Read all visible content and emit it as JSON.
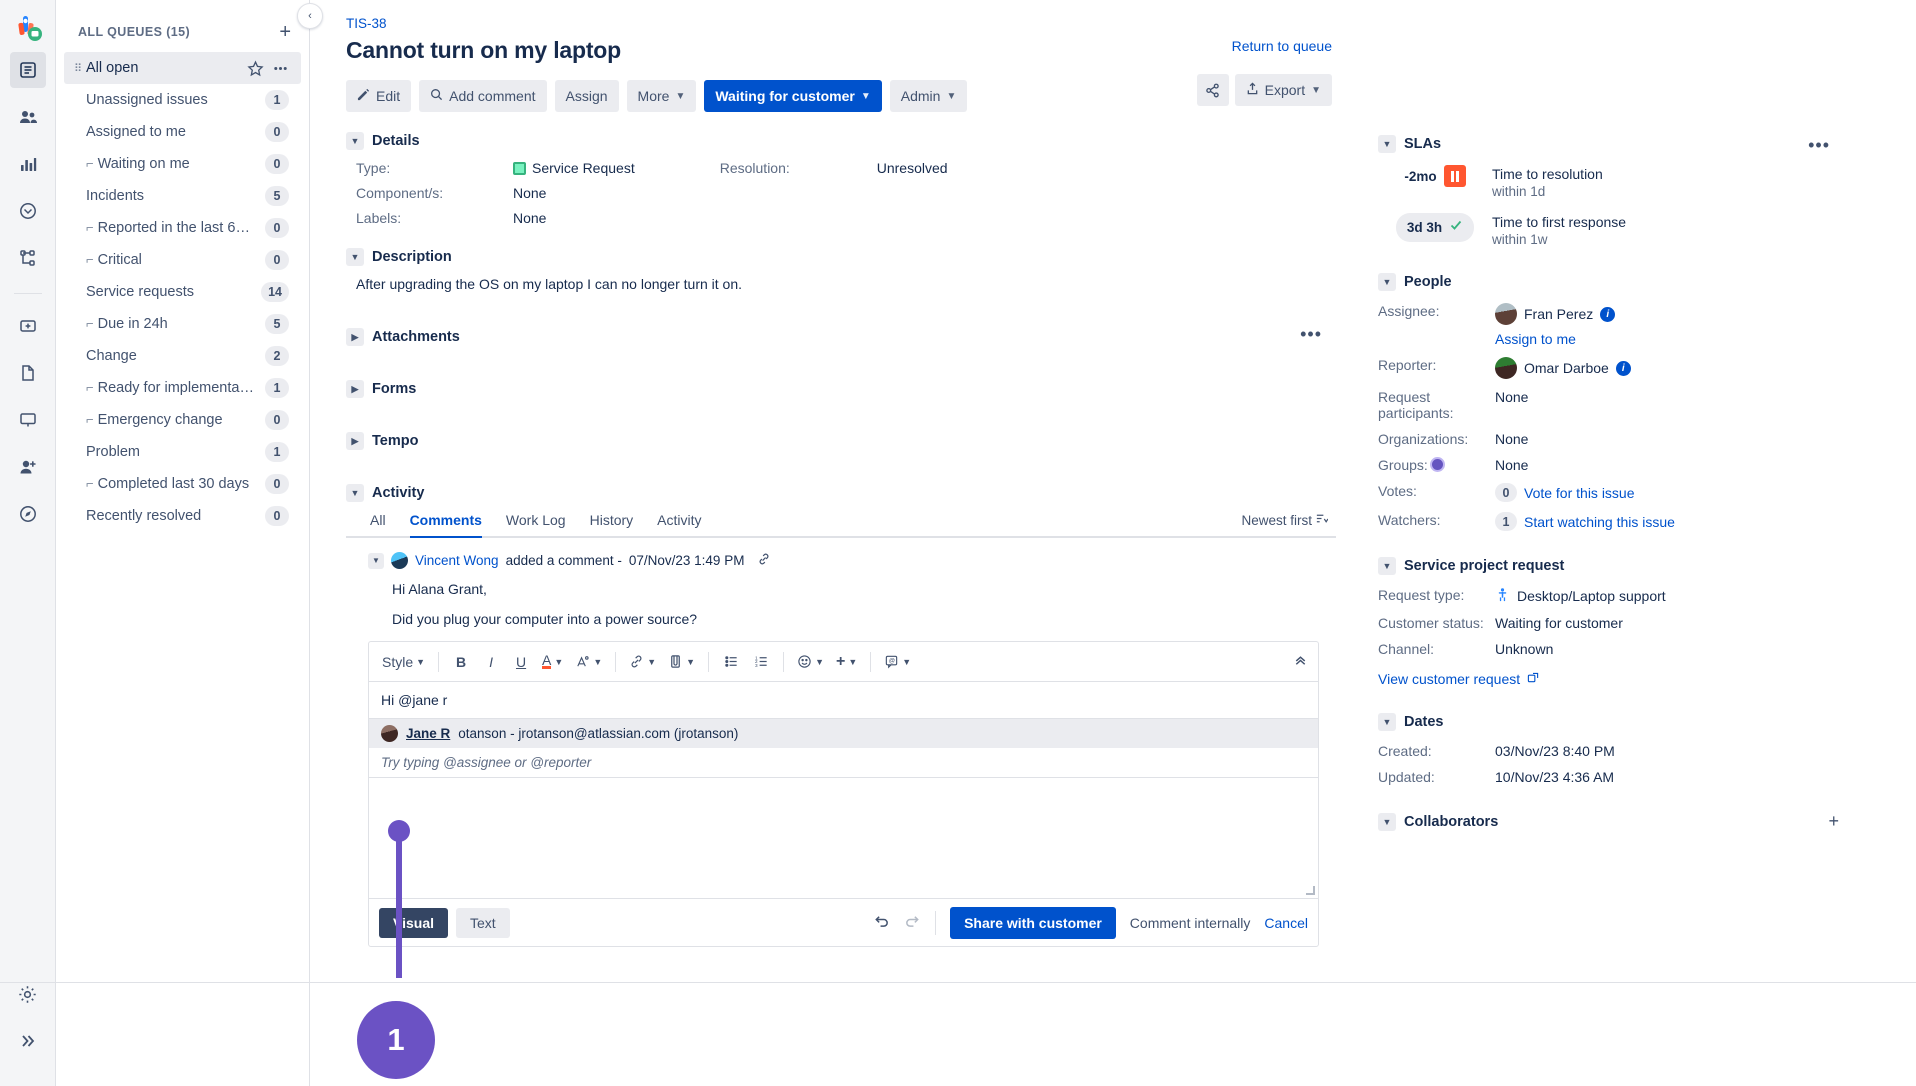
{
  "rail": {
    "logo": "jira-service-management-logo",
    "items": [
      {
        "name": "queues-icon",
        "active": true
      },
      {
        "name": "customers-icon",
        "active": false
      },
      {
        "name": "reports-icon",
        "active": false
      },
      {
        "name": "sla-clock-icon",
        "active": false
      },
      {
        "name": "workflow-icon",
        "active": false
      },
      {
        "name": "add-form-icon",
        "active": false
      },
      {
        "name": "knowledge-base-icon",
        "active": false
      },
      {
        "name": "assets-icon",
        "active": false
      },
      {
        "name": "invite-team-icon",
        "active": false
      },
      {
        "name": "compass-icon",
        "active": false
      }
    ],
    "settings_icon": "gear-icon",
    "expand_icon": "double-chevron-right-icon"
  },
  "queues": {
    "title": "ALL QUEUES (15)",
    "add_label": "+",
    "collapse_label": "‹",
    "items": [
      {
        "label": "All open",
        "count": "",
        "sub": false,
        "selected": true
      },
      {
        "label": "Unassigned issues",
        "count": "1",
        "sub": false,
        "selected": false
      },
      {
        "label": "Assigned to me",
        "count": "0",
        "sub": false,
        "selected": false
      },
      {
        "label": "Waiting on me",
        "count": "0",
        "sub": true,
        "selected": false
      },
      {
        "label": "Incidents",
        "count": "5",
        "sub": false,
        "selected": false
      },
      {
        "label": "Reported in the last 60 ...",
        "count": "0",
        "sub": true,
        "selected": false
      },
      {
        "label": "Critical",
        "count": "0",
        "sub": true,
        "selected": false
      },
      {
        "label": "Service requests",
        "count": "14",
        "sub": false,
        "selected": false
      },
      {
        "label": "Due in 24h",
        "count": "5",
        "sub": true,
        "selected": false
      },
      {
        "label": "Change",
        "count": "2",
        "sub": false,
        "selected": false
      },
      {
        "label": "Ready for implementation",
        "count": "1",
        "sub": true,
        "selected": false
      },
      {
        "label": "Emergency change",
        "count": "0",
        "sub": true,
        "selected": false
      },
      {
        "label": "Problem",
        "count": "1",
        "sub": false,
        "selected": false
      },
      {
        "label": "Completed last 30 days",
        "count": "0",
        "sub": true,
        "selected": false
      },
      {
        "label": "Recently resolved",
        "count": "0",
        "sub": false,
        "selected": false
      }
    ]
  },
  "issue": {
    "key": "TIS-38",
    "title": "Cannot turn on my laptop",
    "return_to_queue": "Return to queue"
  },
  "toolbar": {
    "edit": "Edit",
    "add_comment": "Add comment",
    "assign": "Assign",
    "more": "More",
    "status": "Waiting for customer",
    "admin": "Admin",
    "export": "Export",
    "share_icon": "share-icon"
  },
  "details": {
    "heading": "Details",
    "type_label": "Type:",
    "type_value": "Service Request",
    "components_label": "Component/s:",
    "components_value": "None",
    "labels_label": "Labels:",
    "labels_value": "None",
    "resolution_label": "Resolution:",
    "resolution_value": "Unresolved"
  },
  "description": {
    "heading": "Description",
    "text": "After upgrading the OS on my laptop I can no longer turn it on."
  },
  "sections": {
    "attachments": "Attachments",
    "forms": "Forms",
    "tempo": "Tempo",
    "activity": "Activity"
  },
  "activity": {
    "tabs": [
      {
        "label": "All",
        "active": false
      },
      {
        "label": "Comments",
        "active": true
      },
      {
        "label": "Work Log",
        "active": false
      },
      {
        "label": "History",
        "active": false
      },
      {
        "label": "Activity",
        "active": false
      }
    ],
    "sort": "Newest first",
    "sort_icon": "sort-descending-icon"
  },
  "comment": {
    "author": "Vincent Wong",
    "action": "added a comment -",
    "timestamp": "07/Nov/23 1:49 PM",
    "permalink_icon": "link-icon",
    "line1": "Hi Alana Grant,",
    "line2": "Did you plug your computer into a power source?"
  },
  "editor": {
    "style_label": "Style",
    "tools": [
      {
        "name": "bold-icon",
        "glyph": "B"
      },
      {
        "name": "italic-icon",
        "glyph": "I"
      },
      {
        "name": "underline-icon",
        "glyph": "U"
      },
      {
        "name": "text-color-icon",
        "glyph": "A"
      },
      {
        "name": "text-effects-icon",
        "glyph": "A"
      },
      {
        "name": "link-icon",
        "glyph": "🔗"
      },
      {
        "name": "attachment-icon",
        "glyph": "📎"
      },
      {
        "name": "bullet-list-icon",
        "glyph": "☰"
      },
      {
        "name": "numbered-list-icon",
        "glyph": "☲"
      },
      {
        "name": "emoji-icon",
        "glyph": "☺"
      },
      {
        "name": "insert-more-icon",
        "glyph": "+"
      },
      {
        "name": "mention-icon",
        "glyph": "⌨"
      }
    ],
    "collapse_icon": "chevron-up-double-icon",
    "body_text": "Hi @jane r",
    "mention_name_strong": "Jane R",
    "mention_name_rest": "otanson - jrotanson@atlassian.com (jrotanson)",
    "mention_hint": "Try typing @assignee or @reporter",
    "visual_tab": "Visual",
    "text_tab": "Text",
    "undo_icon": "undo-icon",
    "redo_icon": "redo-icon",
    "share_with_customer": "Share with customer",
    "comment_internally": "Comment internally",
    "cancel": "Cancel"
  },
  "slas": {
    "heading": "SLAs",
    "items": [
      {
        "time": "-2mo",
        "state": "breached",
        "name": "Time to resolution",
        "goal": "within 1d"
      },
      {
        "time": "3d 3h",
        "state": "met",
        "name": "Time to first response",
        "goal": "within 1w"
      }
    ]
  },
  "people": {
    "heading": "People",
    "assignee_label": "Assignee:",
    "assignee_value": "Fran Perez",
    "assign_to_me": "Assign to me",
    "reporter_label": "Reporter:",
    "reporter_value": "Omar Darboe",
    "participants_label": "Request participants:",
    "participants_value": "None",
    "organizations_label": "Organizations:",
    "organizations_value": "None",
    "groups_label": "Groups:",
    "groups_value": "None",
    "votes_label": "Votes:",
    "votes_count": "0",
    "votes_link": "Vote for this issue",
    "watchers_label": "Watchers:",
    "watchers_count": "1",
    "watchers_link": "Start watching this issue"
  },
  "service_request": {
    "heading": "Service project request",
    "request_type_label": "Request type:",
    "request_type_value": "Desktop/Laptop support",
    "customer_status_label": "Customer status:",
    "customer_status_value": "Waiting for customer",
    "channel_label": "Channel:",
    "channel_value": "Unknown",
    "view_customer_request": "View customer request"
  },
  "dates": {
    "heading": "Dates",
    "created_label": "Created:",
    "created_value": "03/Nov/23 8:40 PM",
    "updated_label": "Updated:",
    "updated_value": "10/Nov/23 4:36 AM"
  },
  "collaborators": {
    "heading": "Collaborators",
    "add_label": "+"
  },
  "annotation": {
    "step_number": "1",
    "color": "#6B52C4"
  }
}
